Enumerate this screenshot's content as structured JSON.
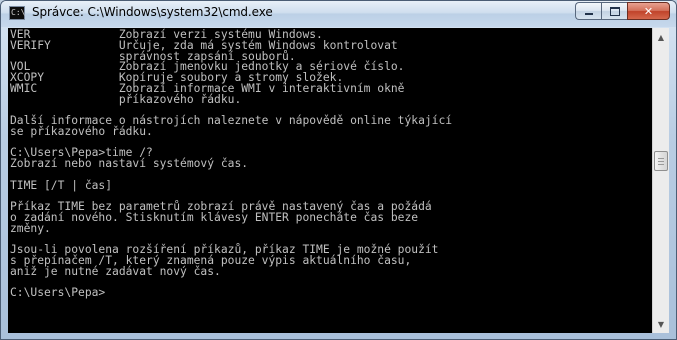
{
  "window": {
    "title": "Správce: C:\\Windows\\system32\\cmd.exe",
    "icon": "console-icon",
    "icon_glyph": "C:\\"
  },
  "caption_buttons": {
    "minimize_icon": "minimize-icon",
    "maximize_icon": "maximize-icon",
    "close_icon": "close-icon",
    "close_glyph": "✕"
  },
  "scrollbar": {
    "up_glyph": "▲",
    "down_glyph": "▼"
  },
  "console": {
    "background": "#000000",
    "foreground": "#c0c0c0",
    "lines": [
      "VER             Zobrazí verzi systému Windows.",
      "VERIFY          Určuje, zda má systém Windows kontrolovat",
      "                správnost zapsání souborů.",
      "VOL             Zobrazí jmenovku jednotky a sériové číslo.",
      "XCOPY           Kopíruje soubory a stromy složek.",
      "WMIC            Zobrazí informace WMI v interaktivním okně",
      "                příkazového řádku.",
      "",
      "Další informace o nástrojích naleznete v nápovědě online týkající",
      "se příkazového řádku.",
      "",
      "C:\\Users\\Pepa>time /?",
      "Zobrazí nebo nastaví systémový čas.",
      "",
      "TIME [/T | čas]",
      "",
      "Příkaz TIME bez parametrů zobrazí právě nastavený čas a požádá",
      "o zadání nového. Stisknutím klávesy ENTER ponecháte čas beze",
      "změny.",
      "",
      "Jsou-li povolena rozšíření příkazů, příkaz TIME je možné použít",
      "s přepínačem /T, který znamená pouze výpis aktuálního času,",
      "aniž je nutné zadávat nový čas.",
      "",
      "C:\\Users\\Pepa>"
    ]
  }
}
